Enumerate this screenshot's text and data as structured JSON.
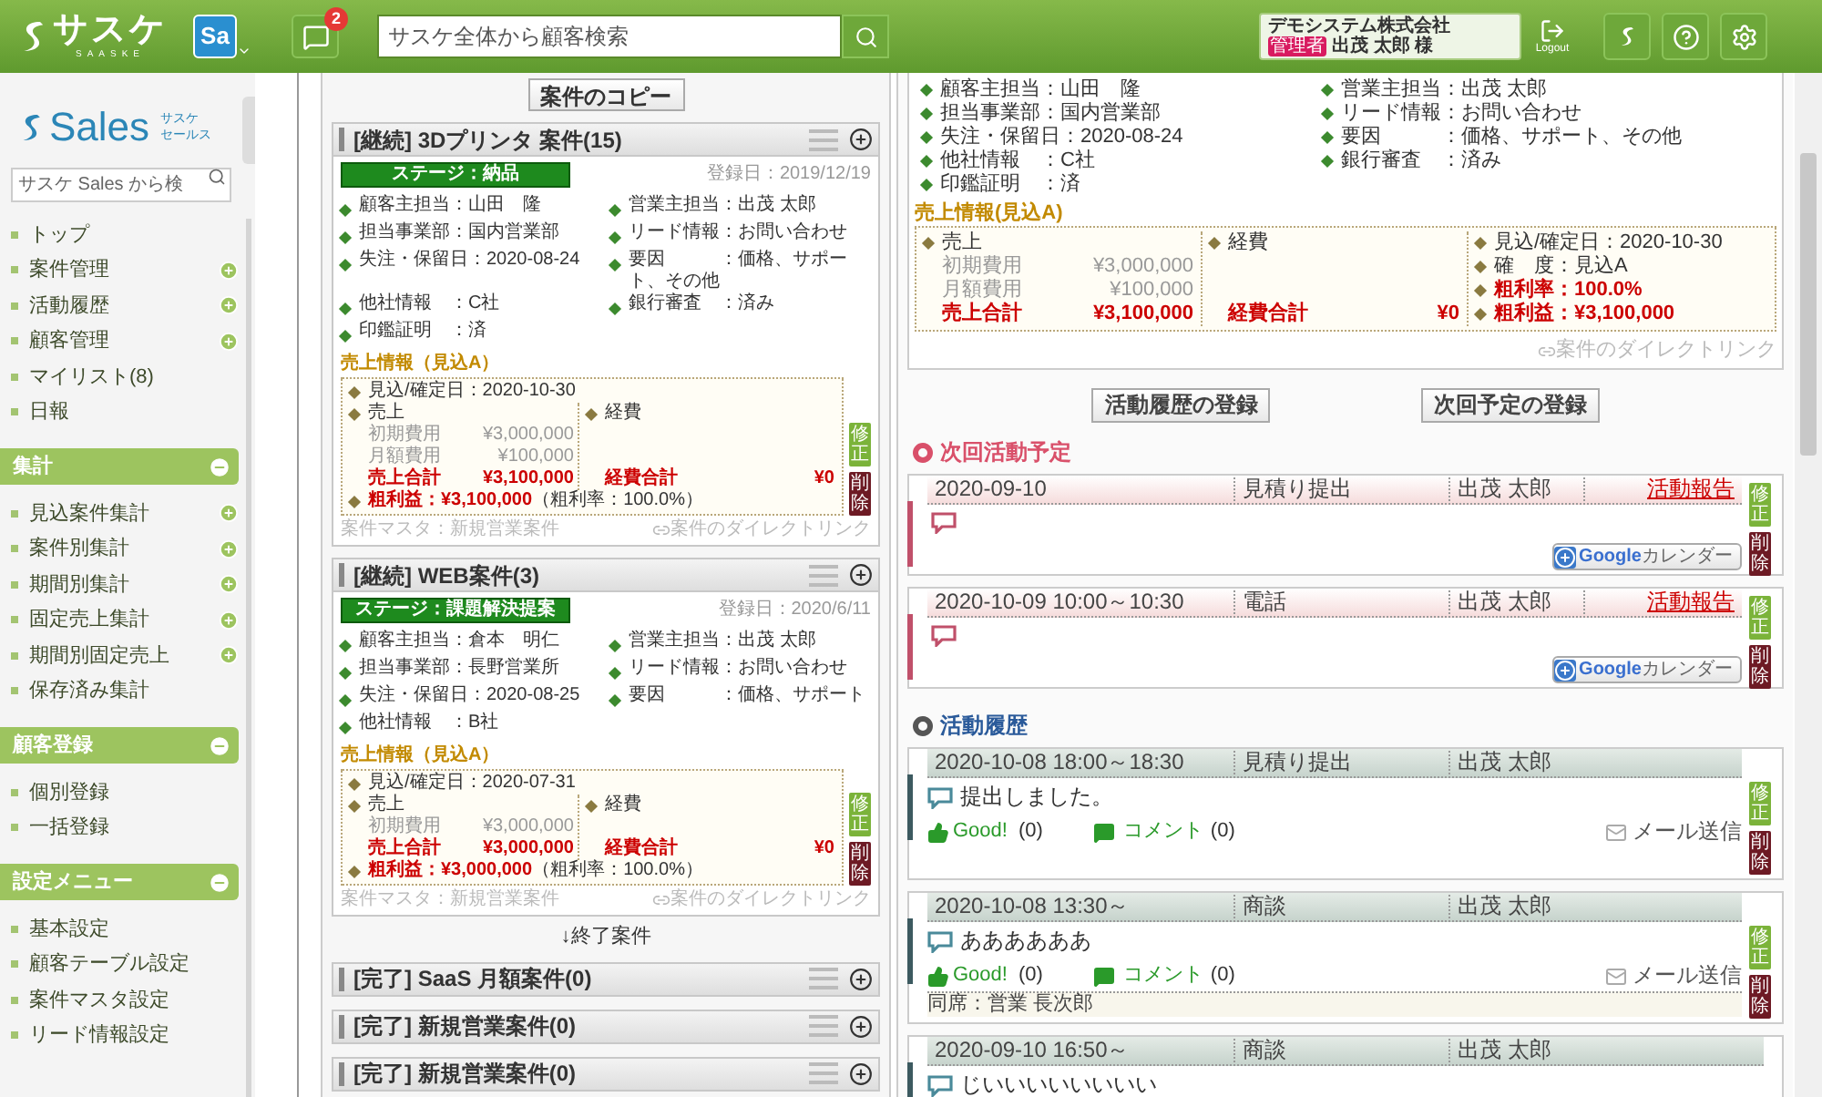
{
  "header": {
    "logo": "サスケ",
    "logo_sub": "SAASKE",
    "app_badge": "Sa",
    "notification_count": "2",
    "search": {
      "placeholder": "サスケ全体から顧客検索"
    },
    "company": "デモシステム株式会社",
    "role": "管理者",
    "user": "出茂 太郎",
    "honorific": "様",
    "logout": "Logout"
  },
  "sidebar": {
    "app_title": "Sales",
    "app_subtitle": [
      "サスケ",
      "セールス"
    ],
    "search": {
      "placeholder": "サスケ Sales から検"
    },
    "sections": [
      {
        "items": [
          {
            "label": "トップ",
            "add": false
          },
          {
            "label": "案件管理",
            "add": true
          },
          {
            "label": "活動履歴",
            "add": true
          },
          {
            "label": "顧客管理",
            "add": true
          },
          {
            "label": "マイリスト(8)",
            "add": false
          },
          {
            "label": "日報",
            "add": false
          }
        ]
      },
      {
        "title": "集計",
        "expanded": true,
        "items": [
          {
            "label": "見込案件集計",
            "add": true
          },
          {
            "label": "案件別集計",
            "add": true
          },
          {
            "label": "期間別集計",
            "add": true
          },
          {
            "label": "固定売上集計",
            "add": true
          },
          {
            "label": "期間別固定売上",
            "add": true
          },
          {
            "label": "保存済み集計",
            "add": false
          }
        ]
      },
      {
        "title": "顧客登録",
        "expanded": true,
        "items": [
          {
            "label": "個別登録",
            "add": false
          },
          {
            "label": "一括登録",
            "add": false
          }
        ]
      },
      {
        "title": "設定メニュー",
        "expanded": true,
        "items": [
          {
            "label": "基本設定",
            "add": false
          },
          {
            "label": "顧客テーブル設定",
            "add": false
          },
          {
            "label": "案件マスタ設定",
            "add": false
          },
          {
            "label": "リード情報設定",
            "add": false
          }
        ]
      }
    ]
  },
  "cases": {
    "copy_button": "案件のコピー",
    "open": [
      {
        "status": "[継続]",
        "title": "3Dプリンタ 案件(15)",
        "stage": "ステージ：納品",
        "registered": "登録日：2019/12/19",
        "fields": [
          "顧客主担当：山田　隆",
          "営業主担当：出茂 太郎",
          "担当事業部：国内営業部",
          "リード情報：お問い合わせ",
          "失注・保留日：2020-08-24",
          "要因　　　：価格、サポート、その他",
          "他社情報　：C社",
          "銀行審査　：済み",
          "印鑑証明　：済"
        ],
        "sales_heading": "売上情報（見込A）",
        "sales": {
          "date": "見込/確定日：2020-10-30",
          "revenue_label": "売上",
          "lines": [
            {
              "label": "初期費用",
              "amount": "¥3,000,000"
            },
            {
              "label": "月額費用",
              "amount": "¥100,000"
            }
          ],
          "revenue_total_label": "売上合計",
          "revenue_total": "¥3,100,000",
          "expense_label": "経費",
          "expense_total_label": "経費合計",
          "expense_total": "¥0",
          "profit": "粗利益：¥3,100,000",
          "profit_rate": "（粗利率：100.0%）"
        },
        "master": "案件マスタ：新規営業案件",
        "direct_link": "案件のダイレクトリンク",
        "edit": "修正",
        "delete": "削除"
      },
      {
        "status": "[継続]",
        "title": "WEB案件(3)",
        "stage": "ステージ：課題解決提案",
        "registered": "登録日：2020/6/11",
        "fields": [
          "顧客主担当：倉本　明仁",
          "営業主担当：出茂 太郎",
          "担当事業部：長野営業所",
          "リード情報：お問い合わせ",
          "失注・保留日：2020-08-25",
          "要因　　　：価格、サポート",
          "他社情報　：B社"
        ],
        "sales_heading": "売上情報（見込A）",
        "sales": {
          "date": "見込/確定日：2020-07-31",
          "revenue_label": "売上",
          "lines": [
            {
              "label": "初期費用",
              "amount": "¥3,000,000"
            }
          ],
          "revenue_total_label": "売上合計",
          "revenue_total": "¥3,000,000",
          "expense_label": "経費",
          "expense_total_label": "経費合計",
          "expense_total": "¥0",
          "profit": "粗利益：¥3,000,000",
          "profit_rate": "（粗利率：100.0%）"
        },
        "master": "案件マスタ：新規営業案件",
        "direct_link": "案件のダイレクトリンク",
        "edit": "修正",
        "delete": "削除"
      }
    ],
    "closed_heading": "↓終了案件",
    "closed": [
      {
        "status": "[完了]",
        "title": "SaaS 月額案件(0)"
      },
      {
        "status": "[完了]",
        "title": "新規営業案件(0)"
      },
      {
        "status": "[完了]",
        "title": "新規営業案件(0)"
      }
    ]
  },
  "detail": {
    "fields": [
      "顧客主担当：山田　隆",
      "営業主担当：出茂 太郎",
      "担当事業部：国内営業部",
      "リード情報：お問い合わせ",
      "失注・保留日：2020-08-24",
      "要因　　　：価格、サポート、その他",
      "他社情報　：C社",
      "銀行審査　：済み",
      "印鑑証明　：済"
    ],
    "sales_heading": "売上情報(見込A)",
    "sales": {
      "revenue_label": "売上",
      "lines": [
        {
          "label": "初期費用",
          "amount": "¥3,000,000"
        },
        {
          "label": "月額費用",
          "amount": "¥100,000"
        }
      ],
      "revenue_total_label": "売上合計",
      "revenue_total": "¥3,100,000",
      "expense_label": "経費",
      "expense_total_label": "経費合計",
      "expense_total": "¥0",
      "summary": [
        {
          "text": "見込/確定日：2020-10-30",
          "emphasis": false
        },
        {
          "text": "確　度：見込A",
          "emphasis": false
        },
        {
          "text": "粗利率：100.0%",
          "emphasis": true
        },
        {
          "text": "粗利益：¥3,100,000",
          "emphasis": true
        }
      ]
    },
    "direct_link": "案件のダイレクトリンク"
  },
  "actions": [
    "活動履歴の登録",
    "次回予定の登録"
  ],
  "schedule": {
    "title": "次回活動予定",
    "entries": [
      {
        "date": "2020-09-10",
        "type": "見積り提出",
        "person": "出茂 太郎",
        "report": "活動報告",
        "calendar_brand": "Google",
        "calendar": "カレンダー",
        "edit": "修正",
        "delete": "削除"
      },
      {
        "date": "2020-10-09 10:00～10:30",
        "type": "電話",
        "person": "出茂 太郎",
        "report": "活動報告",
        "calendar_brand": "Google",
        "calendar": "カレンダー",
        "edit": "修正",
        "delete": "削除"
      }
    ]
  },
  "history": {
    "title": "活動履歴",
    "entries": [
      {
        "date": "2020-10-08 18:00～18:30",
        "type": "見積り提出",
        "person": "出茂 太郎",
        "note": "提出しました。",
        "good": "Good!",
        "good_count": "(0)",
        "comment": "コメント",
        "comment_count": "(0)",
        "mail": "メール送信",
        "edit": "修正",
        "delete": "削除"
      },
      {
        "date": "2020-10-08 13:30～",
        "type": "商談",
        "person": "出茂 太郎",
        "note": "ああああああ",
        "good": "Good!",
        "good_count": "(0)",
        "comment": "コメント",
        "comment_count": "(0)",
        "mail": "メール送信",
        "attendee": "同席：営業 長次郎",
        "edit": "修正",
        "delete": "削除"
      },
      {
        "date": "2020-09-10 16:50～",
        "type": "商談",
        "person": "出茂 太郎",
        "note": "じいいいいいいいい"
      }
    ]
  }
}
